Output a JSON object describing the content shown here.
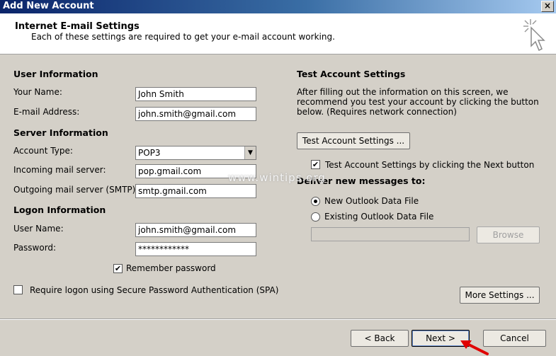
{
  "window": {
    "title": "Add New Account",
    "close_glyph": "×"
  },
  "header": {
    "title": "Internet E-mail Settings",
    "subtitle": "Each of these settings are required to get your e-mail account working."
  },
  "user_info": {
    "heading": "User Information",
    "name_label": "Your Name:",
    "name_value": "John Smith",
    "email_label": "E-mail Address:",
    "email_value": "john.smith@gmail.com"
  },
  "server_info": {
    "heading": "Server Information",
    "account_type_label": "Account Type:",
    "account_type_value": "POP3",
    "incoming_label": "Incoming mail server:",
    "incoming_value": "pop.gmail.com",
    "outgoing_label": "Outgoing mail server (SMTP):",
    "outgoing_value": "smtp.gmail.com"
  },
  "logon_info": {
    "heading": "Logon Information",
    "username_label": "User Name:",
    "username_value": "john.smith@gmail.com",
    "password_label": "Password:",
    "password_value": "************",
    "remember_label": "Remember password",
    "remember_checked": true,
    "spa_label": "Require logon using Secure Password Authentication (SPA)",
    "spa_checked": false
  },
  "test_settings": {
    "heading": "Test Account Settings",
    "description_line1": "After filling out the information on this screen, we",
    "description_line2": "recommend you test your account by clicking the button",
    "description_line3": "below. (Requires network connection)",
    "test_button": "Test Account Settings ...",
    "auto_test_label": "Test Account Settings by clicking the Next button",
    "auto_test_checked": true
  },
  "deliver": {
    "heading": "Deliver new messages to:",
    "new_file_label": "New Outlook Data File",
    "existing_file_label": "Existing Outlook Data File",
    "existing_file_path": "",
    "browse_button": "Browse",
    "selected": "new"
  },
  "more_settings_button": "More Settings ...",
  "footer": {
    "back_button": "< Back",
    "next_button": "Next >",
    "cancel_button": "Cancel"
  },
  "watermark": "www.wintips.org",
  "icons": {
    "setup_cursor": "sparkle-cursor-icon",
    "dropdown": "chevron-down-icon",
    "annotation": "red-arrow-icon"
  },
  "colors": {
    "titlebar": "#0a246a",
    "dialog_bg": "#d4d0c8",
    "annotation_arrow": "#e00000"
  }
}
